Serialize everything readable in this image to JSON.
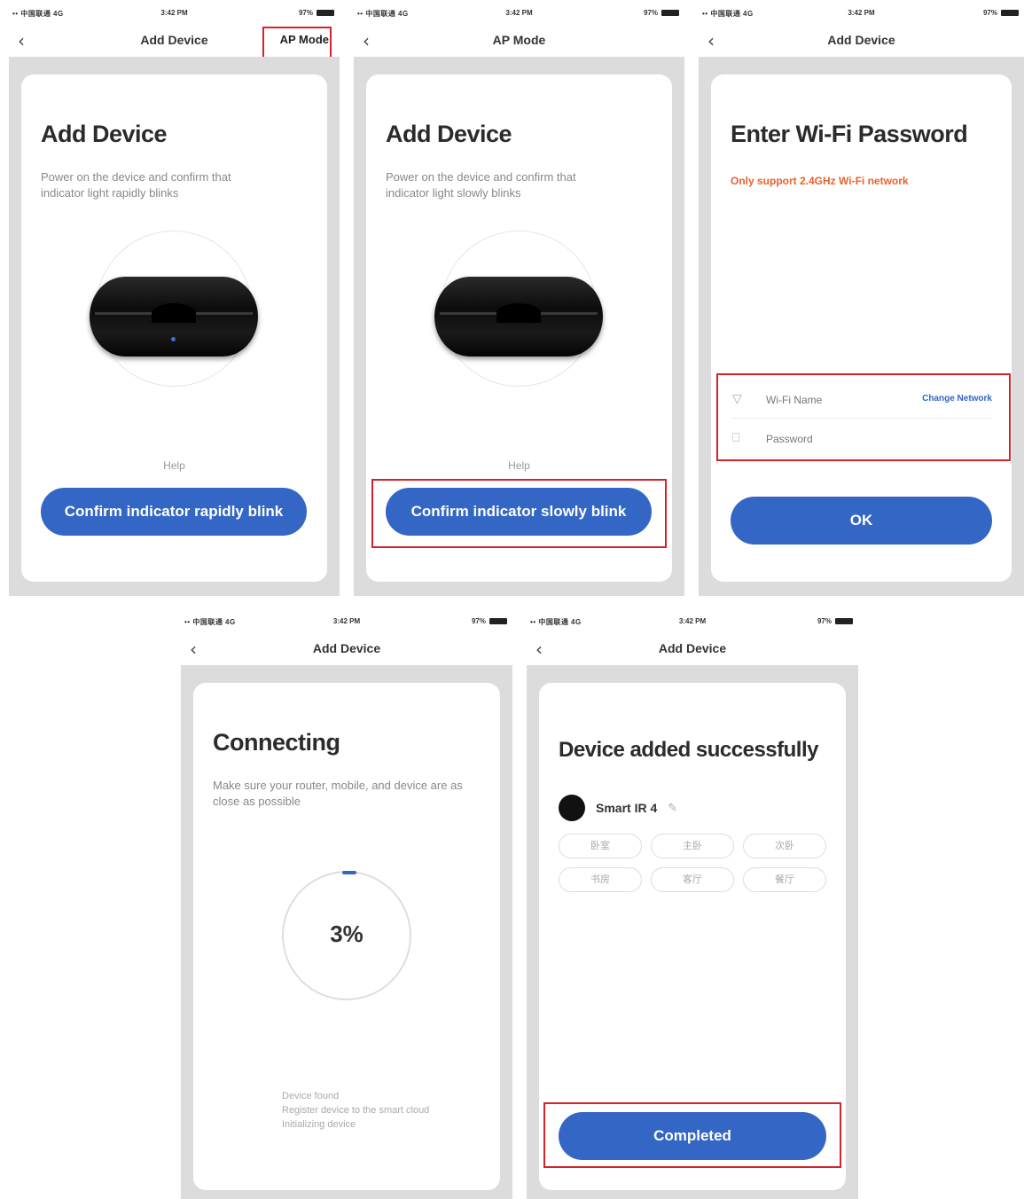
{
  "status": {
    "carrier": "•• 中国联通 4G",
    "time": "3:42 PM",
    "battery": "97%"
  },
  "screens": [
    {
      "nav_title": "Add Device",
      "nav_right": "AP Mode",
      "heading": "Add Device",
      "description": "Power on the device and confirm that indicator light rapidly blinks",
      "help": "Help",
      "button": "Confirm indicator rapidly blink"
    },
    {
      "nav_title": "AP Mode",
      "heading": "Add Device",
      "description": "Power on the device and confirm that indicator light slowly blinks",
      "help": "Help",
      "button": "Confirm indicator slowly blink"
    },
    {
      "nav_title": "Add Device",
      "heading": "Enter Wi-Fi Password",
      "warning": "Only support 2.4GHz Wi-Fi network",
      "wifi_placeholder": "Wi-Fi Name",
      "change_network": "Change Network",
      "password_placeholder": "Password",
      "button": "OK"
    },
    {
      "nav_title": "Add Device",
      "heading": "Connecting",
      "description": "Make sure your router, mobile, and device are as close as possible",
      "progress_label": "3%",
      "progress": 0.03,
      "steps": [
        "Device found",
        "Register device to the smart cloud",
        "Initializing device"
      ]
    },
    {
      "nav_title": "Add Device",
      "heading": "Device added successfully",
      "device_name": "Smart IR 4",
      "rooms": [
        "卧室",
        "主卧",
        "次卧",
        "书房",
        "客厅",
        "餐厅"
      ],
      "button": "Completed"
    }
  ]
}
